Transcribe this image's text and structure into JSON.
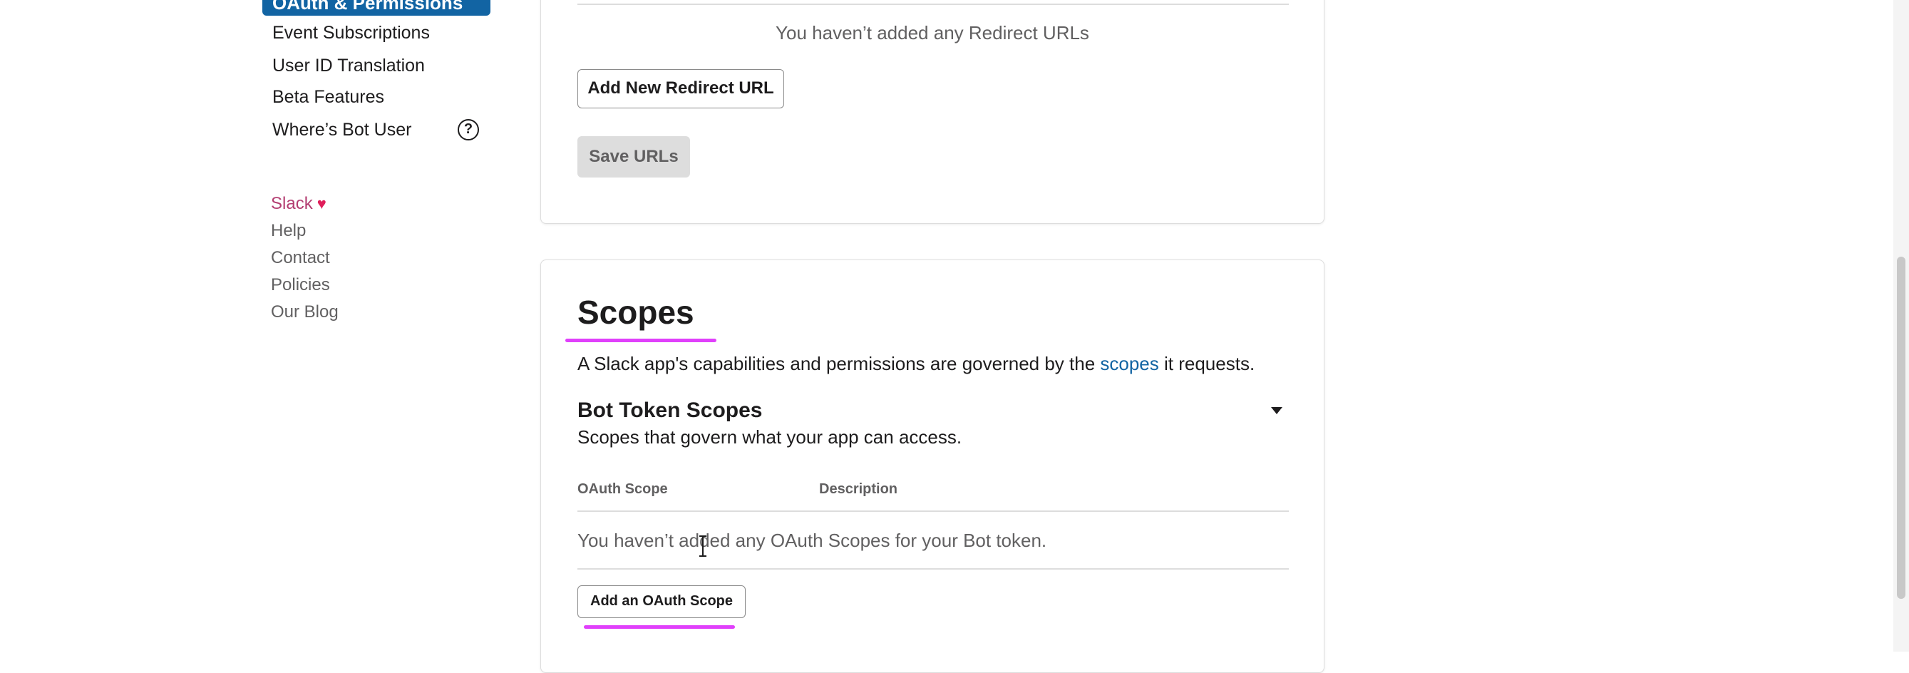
{
  "sidebar": {
    "active_item": "OAuth & Permissions",
    "items": [
      {
        "label": "Event Subscriptions"
      },
      {
        "label": "User ID Translation"
      },
      {
        "label": "Beta Features"
      },
      {
        "label": "Where’s Bot User"
      }
    ],
    "help_icon_glyph": "?",
    "footer": {
      "slack": "Slack",
      "heart": "♥",
      "help": "Help",
      "contact": "Contact",
      "policies": "Policies",
      "blog": "Our Blog"
    }
  },
  "redirect": {
    "empty_text": "You haven’t added any Redirect URLs",
    "add_button": "Add New Redirect URL",
    "save_button": "Save URLs"
  },
  "scopes": {
    "title": "Scopes",
    "description_before": "A Slack app's capabilities and permissions are governed by the ",
    "description_link": "scopes",
    "description_after": " it requests.",
    "bot_section": {
      "title": "Bot Token Scopes",
      "subtitle": "Scopes that govern what your app can access.",
      "columns": [
        "OAuth Scope",
        "Description"
      ],
      "empty_text": "You haven’t added any OAuth Scopes for your Bot token.",
      "add_button": "Add an OAuth Scope"
    }
  },
  "colors": {
    "accent": "#1264a3",
    "highlight": "#e040fb",
    "slack_link": "#b33d71"
  }
}
